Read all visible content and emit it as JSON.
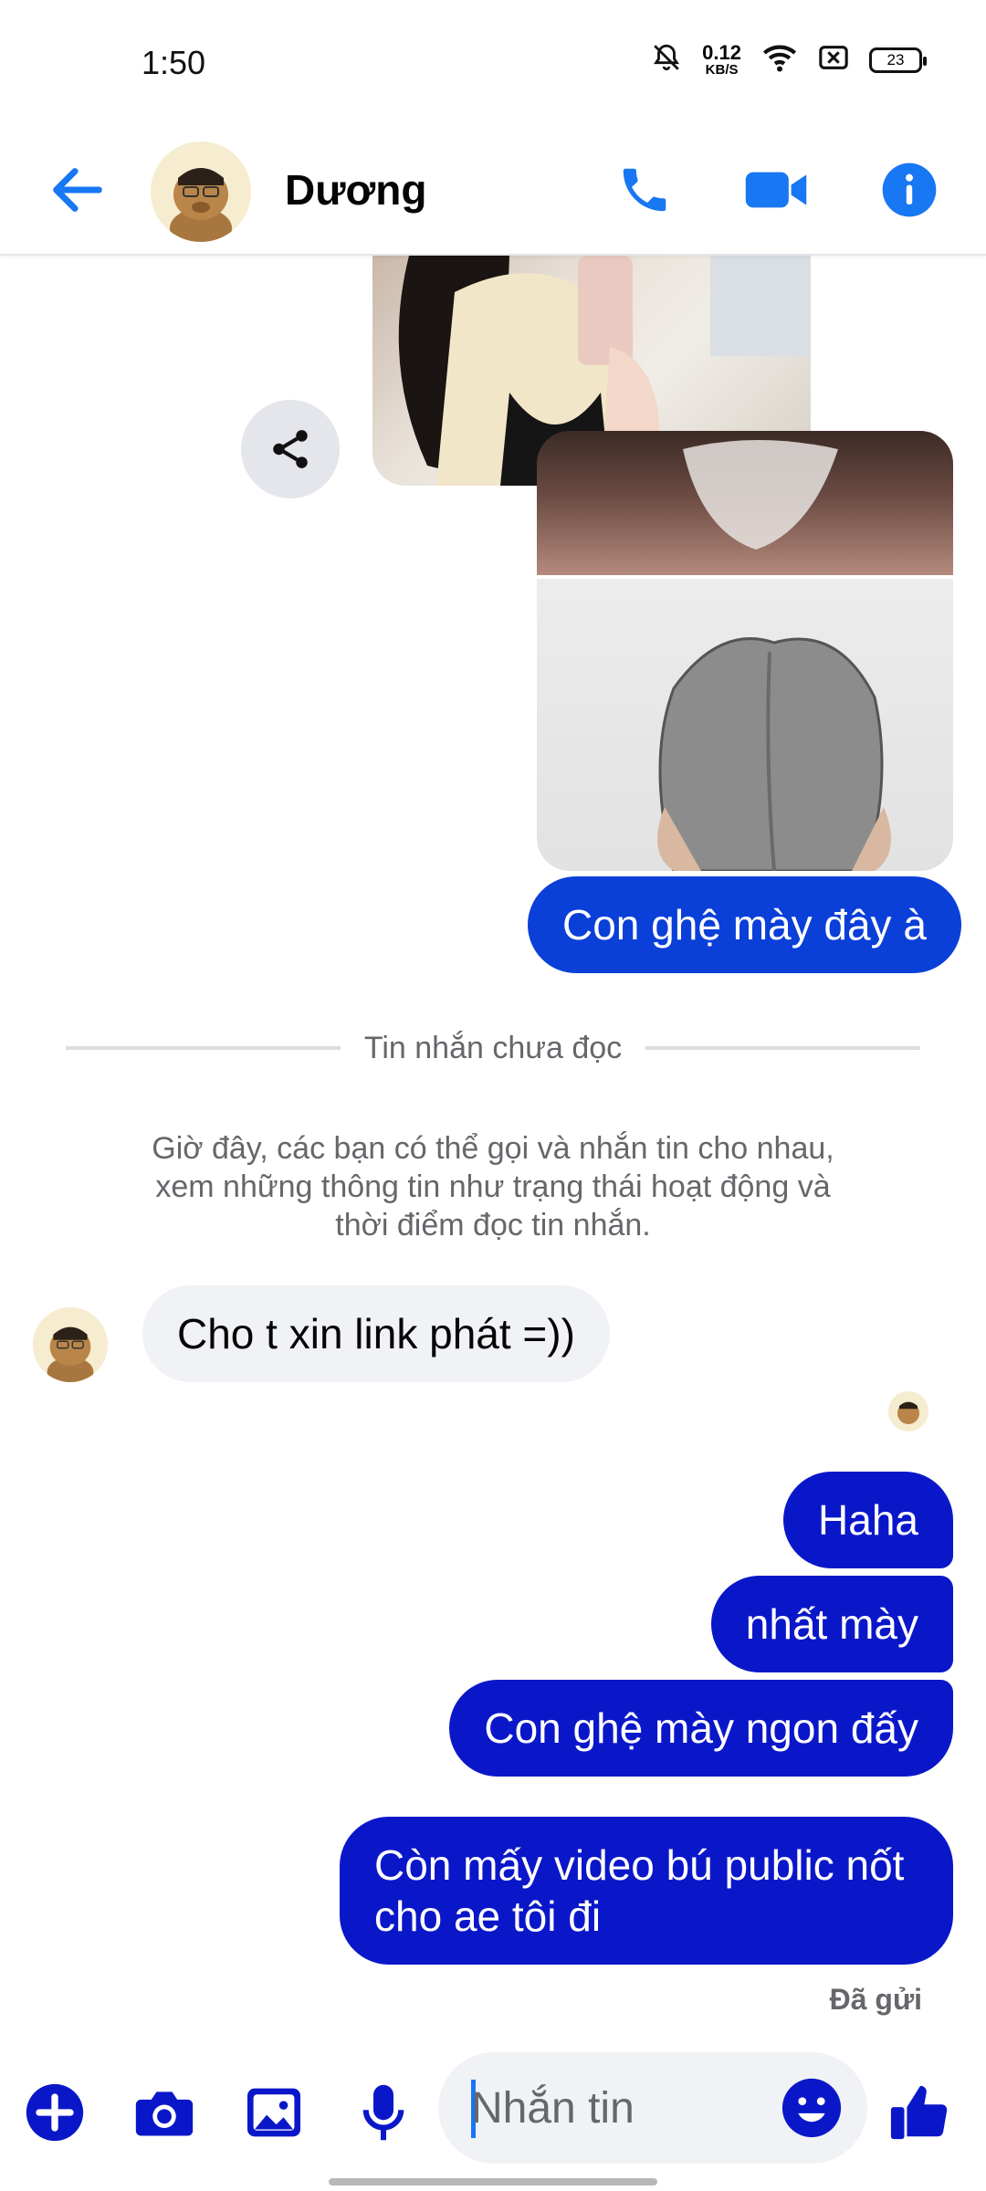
{
  "status_bar": {
    "time": "1:50",
    "net_speed_value": "0.12",
    "net_speed_unit": "KB/S",
    "battery": "23"
  },
  "header": {
    "contact_name": "Dương",
    "icons": [
      "back-arrow-icon",
      "phone-icon",
      "video-camera-icon",
      "info-icon"
    ],
    "accent_color": "#1877f2"
  },
  "messages": {
    "out_1": "Con ghệ mày đây à",
    "unread_divider": "Tin nhắn chưa đọc",
    "system_notice": "Giờ đây, các bạn có thể gọi và nhắn tin cho nhau, xem những thông tin như trạng thái hoạt động và thời điểm đọc tin nhắn.",
    "in_1": "Cho t xin link phát =))",
    "out_2": "Haha",
    "out_3": "nhất mày",
    "out_4": "Con ghệ mày ngon đấy",
    "out_5": "Còn mấy video bú public nốt cho ae tôi đi",
    "sent_status": "Đã gửi"
  },
  "composer": {
    "placeholder": "Nhắn tin",
    "icons": [
      "plus-icon",
      "camera-icon",
      "image-icon",
      "microphone-icon",
      "emoji-icon",
      "thumbs-up-icon"
    ]
  },
  "colors": {
    "outgoing_bubble": "#0a17c9",
    "outgoing_bubble_top": "#0a3fd8",
    "incoming_bubble": "#f0f2f5"
  }
}
